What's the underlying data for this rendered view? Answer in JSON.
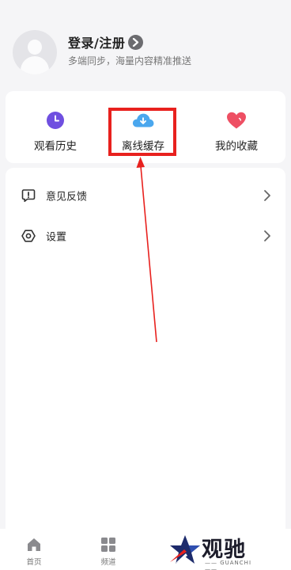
{
  "profile": {
    "login_label": "登录/注册",
    "subtitle": "多端同步，海量内容精准推送"
  },
  "quick_actions": [
    {
      "label": "观看历史",
      "icon": "clock-icon",
      "color": "#6f4fe0"
    },
    {
      "label": "离线缓存",
      "icon": "cloud-download-icon",
      "color": "#4aa7ee"
    },
    {
      "label": "我的收藏",
      "icon": "heart-icon",
      "color": "#ee4f63"
    }
  ],
  "menu": [
    {
      "label": "意见反馈",
      "icon": "feedback-icon"
    },
    {
      "label": "设置",
      "icon": "settings-icon"
    }
  ],
  "bottom_nav": [
    {
      "label": "首页",
      "icon": "home-icon"
    },
    {
      "label": "频道",
      "icon": "grid-icon"
    }
  ],
  "watermark": {
    "text": "观驰",
    "sub": "—— GUANCHI ——"
  },
  "colors": {
    "highlight": "#e8211e",
    "background": "#f5f5f7"
  }
}
